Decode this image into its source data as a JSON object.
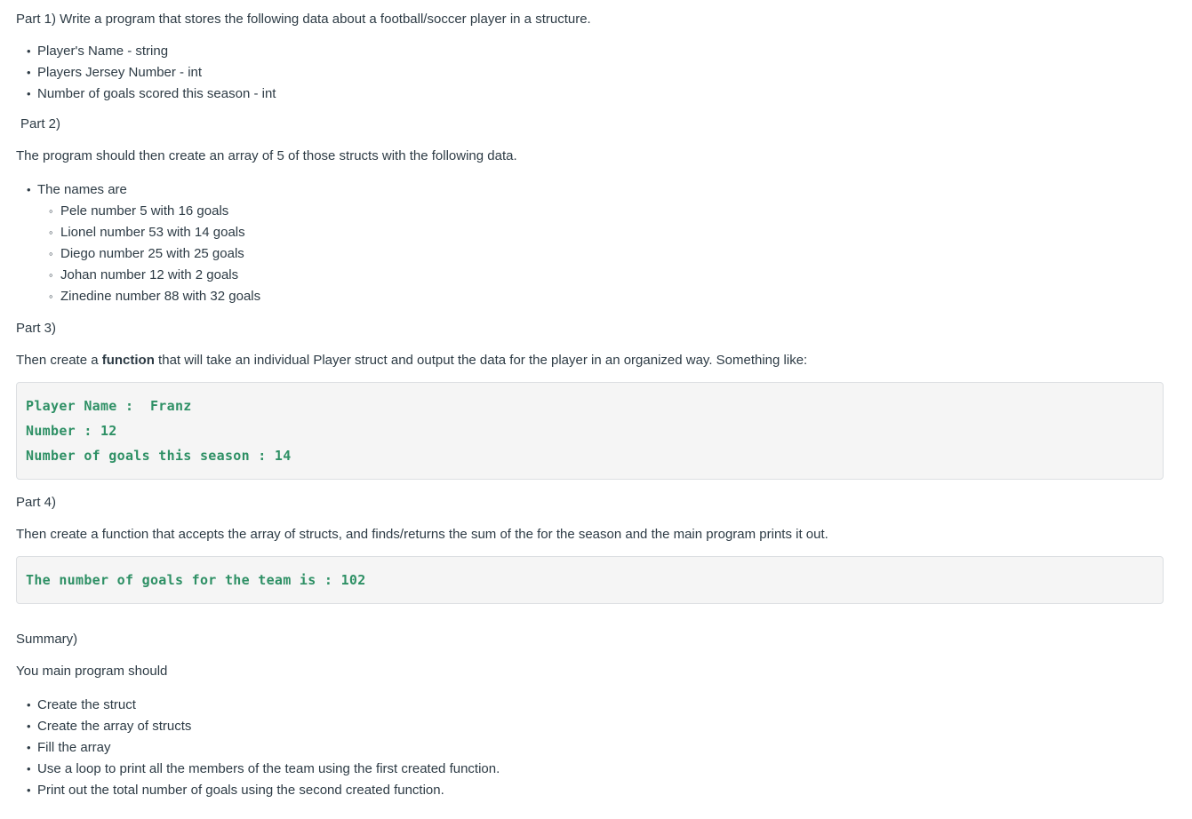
{
  "part1": {
    "heading": "Part 1)  Write a program that stores the following data about a football/soccer player in a structure.",
    "items": [
      "Player's Name - string",
      "Players Jersey Number - int",
      "Number of goals scored this season - int"
    ]
  },
  "part2": {
    "label": "Part 2)",
    "intro": "The program should then create an array of 5 of those structs with the following data.",
    "list_heading": "The names are",
    "players": [
      "Pele number 5 with 16 goals",
      "Lionel number 53 with 14 goals",
      "Diego number 25 with 25 goals",
      "Johan number 12 with 2 goals",
      "Zinedine number 88 with 32 goals"
    ]
  },
  "part3": {
    "label": "Part 3)",
    "text_before_bold": "Then create a ",
    "bold_word": "function",
    "text_after_bold": " that will take an individual Player struct and output the data for the player in an organized way.   Something like:",
    "code_lines": [
      "Player Name :  Franz",
      "Number : 12",
      "Number of goals this season : 14"
    ]
  },
  "part4": {
    "label": "Part 4)",
    "text": "Then create a function that accepts the array of structs, and finds/returns the sum of the for the season and the main program prints it out.",
    "code_lines": [
      "The number of goals for the team is : 102"
    ]
  },
  "summary": {
    "label": "Summary)",
    "intro": "You main program should",
    "items": [
      "Create the struct",
      "Create the array of structs",
      "Fill the array",
      "Use a loop to print all the members of the team using the first created function.",
      "Print out the total number of goals using the second created function."
    ]
  },
  "colors": {
    "text": "#2d3b45",
    "code_text": "#2e9065",
    "code_bg": "#f5f5f5",
    "code_border": "#dcdfe2",
    "page_bg": "#ffffff"
  }
}
